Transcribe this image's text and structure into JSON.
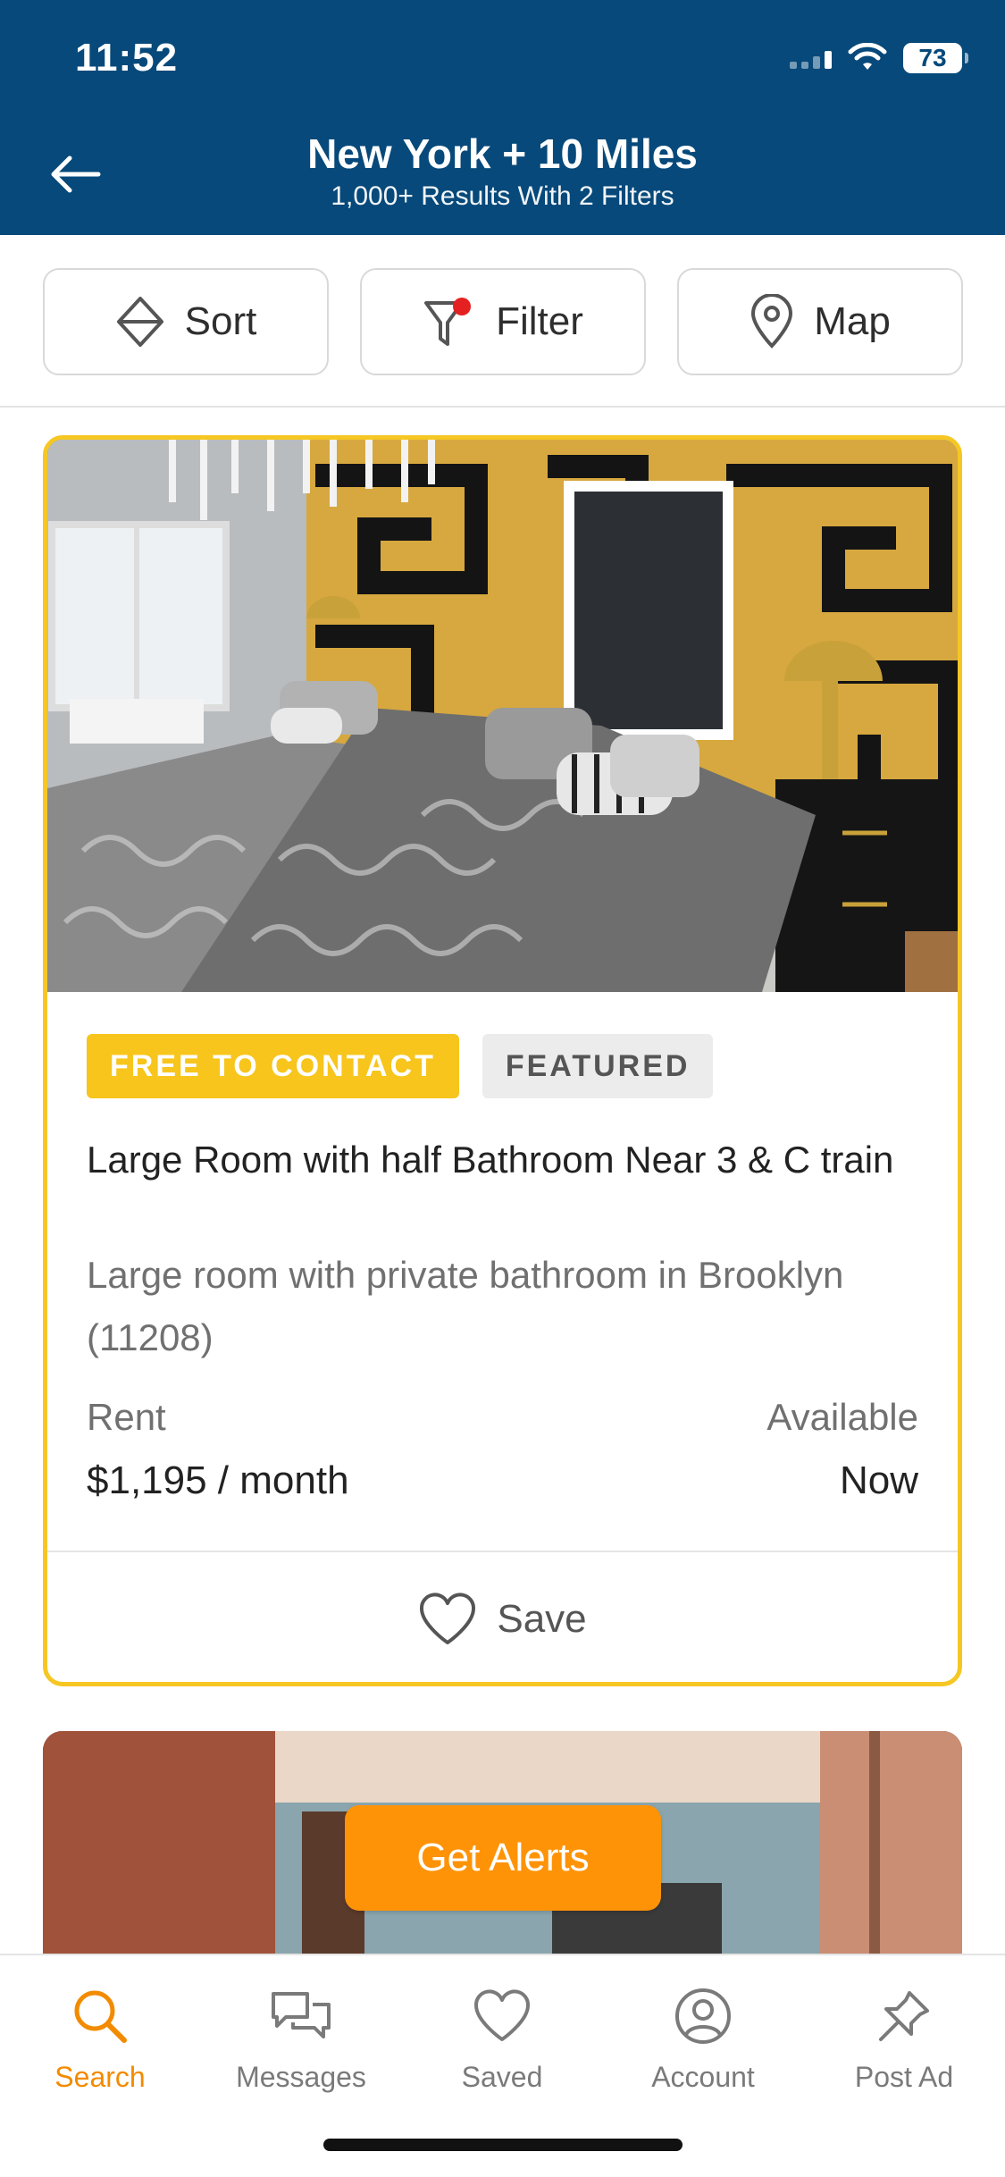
{
  "status_bar": {
    "time": "11:52",
    "battery": "73"
  },
  "header": {
    "title": "New York + 10 Miles",
    "subtitle": "1,000+ Results With 2 Filters",
    "back_icon": "arrow-left-icon"
  },
  "toolbar": {
    "sort_label": "Sort",
    "filter_label": "Filter",
    "map_label": "Map"
  },
  "listing": {
    "badge_free": "FREE TO CONTACT",
    "badge_featured": "FEATURED",
    "title": "Large Room with half Bathroom Near 3 & C train",
    "description": "Large room with private bathroom in Brooklyn (11208)",
    "rent_label": "Rent",
    "rent_value": "$1,195 / month",
    "available_label": "Available",
    "available_value": "Now",
    "save_label": "Save"
  },
  "alerts_button": "Get Alerts",
  "tabs": [
    {
      "label": "Search",
      "icon": "search-icon",
      "active": true
    },
    {
      "label": "Messages",
      "icon": "messages-icon",
      "active": false
    },
    {
      "label": "Saved",
      "icon": "heart-icon",
      "active": false
    },
    {
      "label": "Account",
      "icon": "account-icon",
      "active": false
    },
    {
      "label": "Post Ad",
      "icon": "pin-icon",
      "active": false
    }
  ],
  "colors": {
    "header_bg": "#06497a",
    "featured_border": "#f6c724",
    "accent_orange": "#ff9307",
    "tab_active": "#f28b00"
  }
}
